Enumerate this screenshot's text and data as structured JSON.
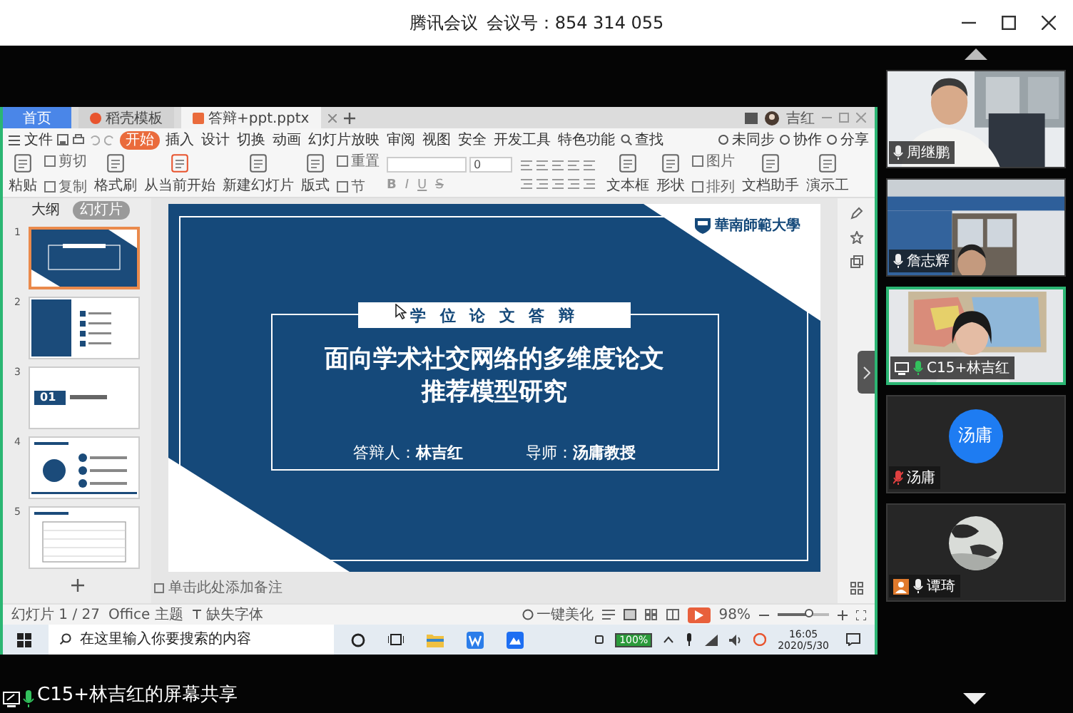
{
  "meeting": {
    "app": "腾讯会议",
    "meeting_id": "会议号：854 314 055"
  },
  "wps": {
    "tabs": [
      {
        "label": "首页",
        "kind": "home",
        "selected": false
      },
      {
        "label": "稻壳模板",
        "kind": "template",
        "selected": false
      },
      {
        "label": "答辩+ppt.pptx",
        "kind": "document",
        "selected": true
      }
    ],
    "user": "吉红",
    "file_menu": "文件",
    "ribbon_tabs": [
      {
        "label": "开始",
        "selected": true
      },
      {
        "label": "插入",
        "selected": false
      },
      {
        "label": "设计",
        "selected": false
      },
      {
        "label": "切换",
        "selected": false
      },
      {
        "label": "动画",
        "selected": false
      },
      {
        "label": "幻灯片放映",
        "selected": false
      },
      {
        "label": "审阅",
        "selected": false
      },
      {
        "label": "视图",
        "selected": false
      },
      {
        "label": "安全",
        "selected": false
      },
      {
        "label": "开发工具",
        "selected": false
      },
      {
        "label": "特色功能",
        "selected": false
      }
    ],
    "search": "查找",
    "actions": [
      "未同步",
      "协作",
      "分享"
    ],
    "tools": [
      {
        "kind": "big",
        "label": "粘贴"
      },
      {
        "kind": "stack",
        "items": [
          "剪切",
          "复制"
        ]
      },
      {
        "kind": "big",
        "label": "格式刷"
      },
      {
        "kind": "big",
        "label": "从当前开始"
      },
      {
        "kind": "big",
        "label": "新建幻灯片"
      },
      {
        "kind": "big",
        "label": "版式"
      },
      {
        "kind": "stack",
        "items": [
          "重置",
          "节"
        ]
      },
      {
        "kind": "font",
        "size": "0",
        "formats": [
          "B",
          "I",
          "U",
          "S"
        ]
      },
      {
        "kind": "paragraph"
      },
      {
        "kind": "big",
        "label": "文本框"
      },
      {
        "kind": "big",
        "label": "形状"
      },
      {
        "kind": "stack",
        "items": [
          "图片",
          "排列"
        ]
      },
      {
        "kind": "big",
        "label": "文档助手"
      },
      {
        "kind": "big",
        "label": "演示工"
      }
    ],
    "panel_tabs": [
      {
        "label": "大纲",
        "selected": false
      },
      {
        "label": "幻灯片",
        "selected": true
      }
    ],
    "thumbnails": [
      {
        "number": "1",
        "kind": "title",
        "selected": true
      },
      {
        "number": "2",
        "kind": "contents",
        "selected": false
      },
      {
        "number": "3",
        "kind": "section",
        "text": "01",
        "selected": false
      },
      {
        "number": "4",
        "kind": "diagram",
        "selected": false
      },
      {
        "number": "5",
        "kind": "table",
        "selected": false
      }
    ],
    "slide": {
      "logo": "華南師範大學",
      "badge": "学 位 论 文 答 辩",
      "title": [
        "面向学术社交网络的多维度论文",
        "推荐模型研究"
      ],
      "presenter": "答辩人：**林吉红**",
      "advisor": "导师：**汤庸教授**"
    },
    "notes": "单击此处添加备注",
    "status": {
      "slide": "幻灯片 1 / 27",
      "theme": "Office 主题",
      "fonts": "缺失字体",
      "beautify": "一键美化",
      "zoom": "98%",
      "level": 0.6
    }
  },
  "taskbar": {
    "placeholder": "在这里输入你要搜索的内容",
    "battery": "100%",
    "time": "16:05",
    "date": "2020/5/30"
  },
  "participants": [
    {
      "name": "周继鹏",
      "kind": "video",
      "muted": false,
      "speaking": false,
      "sharing": false,
      "host": false
    },
    {
      "name": "詹志辉",
      "kind": "video",
      "muted": false,
      "speaking": false,
      "sharing": false,
      "host": false
    },
    {
      "name": "C15+林吉红",
      "kind": "video",
      "muted": false,
      "speaking": true,
      "sharing": true,
      "host": false
    },
    {
      "name": "汤庸",
      "kind": "avatar",
      "avatar_text": "汤庸",
      "muted": true,
      "speaking": false,
      "sharing": false,
      "host": false
    },
    {
      "name": "谭琦",
      "muted": false,
      "speaking": false,
      "sharing": false,
      "host": true
    }
  ],
  "share_label": "C15+林吉红的屏幕共享"
}
